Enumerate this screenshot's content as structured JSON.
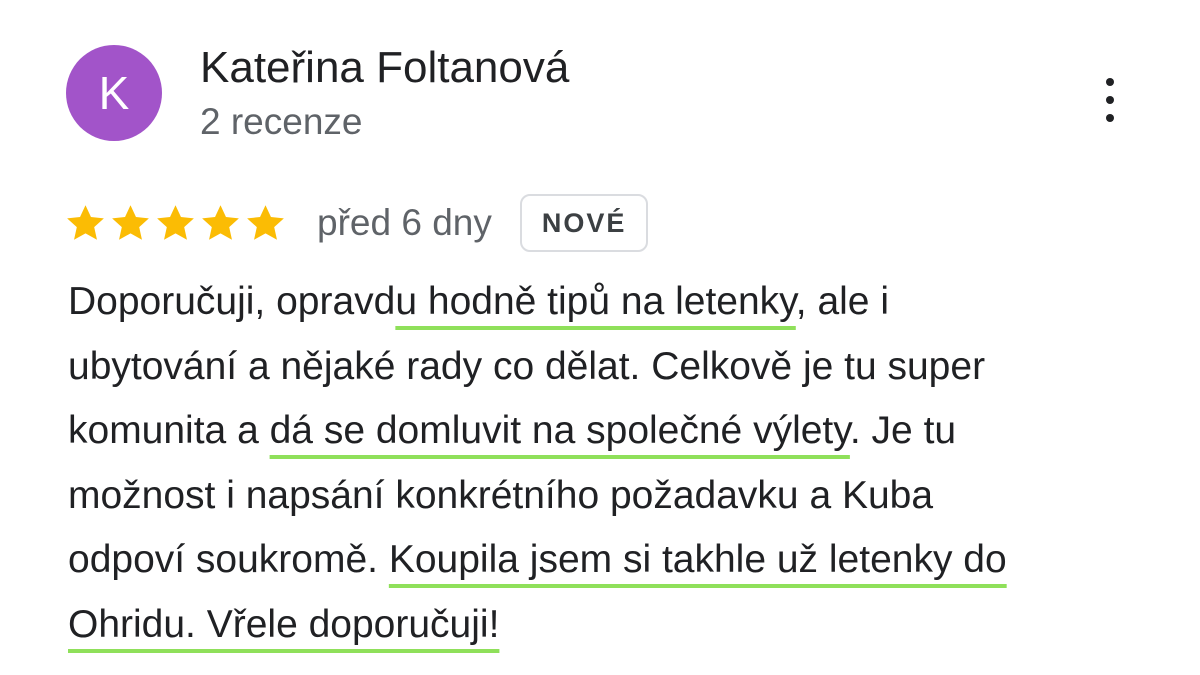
{
  "review": {
    "author": {
      "initial": "K",
      "name": "Kateřina Foltanová",
      "review_count": "2 recenze",
      "avatar_color": "#a254c9"
    },
    "rating": 5,
    "rating_max": 5,
    "star_color": "#fbbc04",
    "time_ago": "před 6 dny",
    "badge": "NOVÉ",
    "menu_icon": "more-vertical-icon",
    "highlight_color": "#8fe05a",
    "text_lines": [
      {
        "before": "Doporučuji, opravd",
        "highlight": "u hodně tipů na letenky",
        "after": ", ale i"
      },
      {
        "before": "ubytování a nějaké rady co dělat. Celkově je tu super",
        "highlight": "",
        "after": ""
      },
      {
        "before": "komunita a ",
        "highlight": "dá se domluvit na společné výlety",
        "after": ". Je tu"
      },
      {
        "before": "možnost i napsání konkrétního požadavku a Kuba",
        "highlight": "",
        "after": ""
      },
      {
        "before": "odpoví soukromě. ",
        "highlight": "Koupila jsem si takhle už letenky do",
        "after": ""
      },
      {
        "before": "",
        "highlight": "Ohridu. Vřele doporučuji!",
        "after": ""
      }
    ]
  }
}
